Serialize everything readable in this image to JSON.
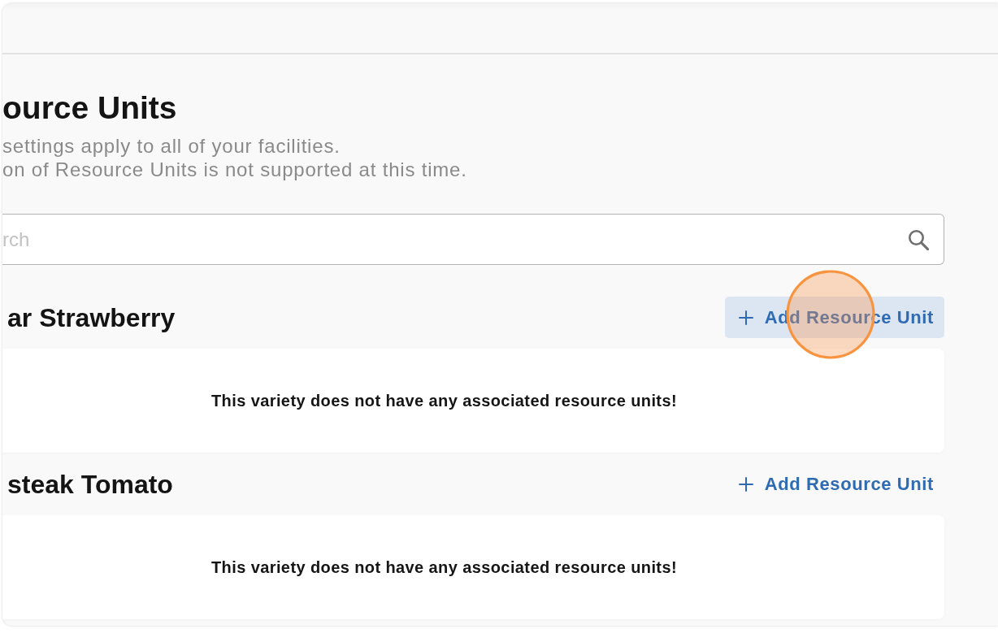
{
  "page": {
    "title": "ource Units",
    "description_lines": [
      "settings apply to all of your facilities.",
      "on of Resource Units is not supported at this time."
    ]
  },
  "search": {
    "placeholder": "rch"
  },
  "varieties": [
    {
      "name": "ar Strawberry",
      "add_button": {
        "label": "Add Resource Unit",
        "hovered": true,
        "click_marker": true
      },
      "empty_message": "This variety does not have any associated resource units!"
    },
    {
      "name": "steak Tomato",
      "add_button": {
        "label": "Add Resource Unit",
        "hovered": false,
        "click_marker": false
      },
      "empty_message": "This variety does not have any associated resource units!"
    }
  ]
}
